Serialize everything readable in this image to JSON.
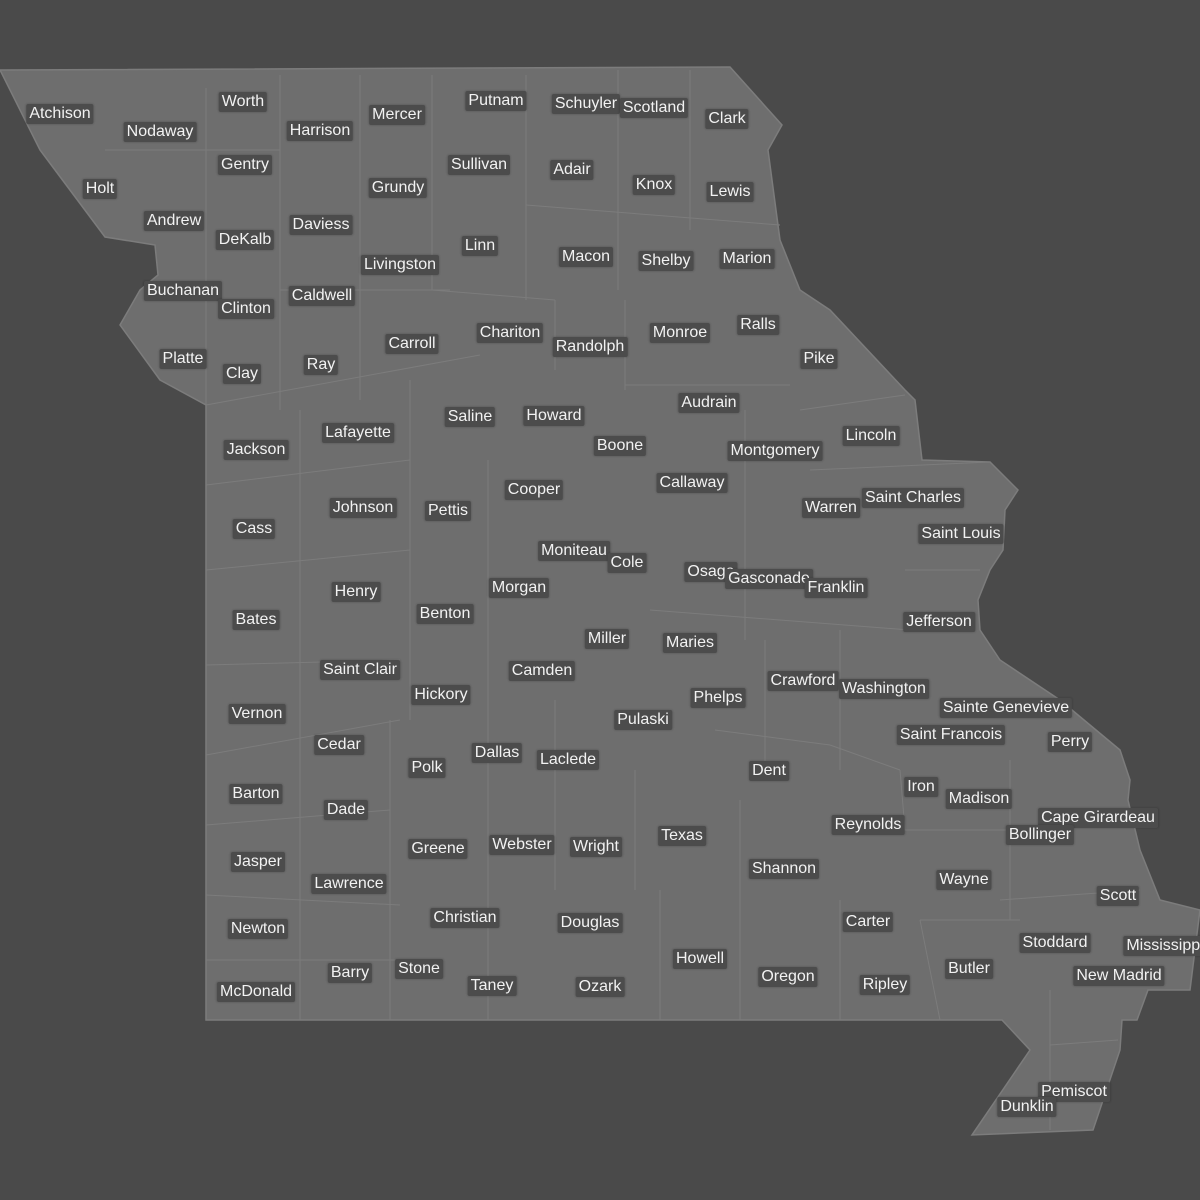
{
  "map": {
    "colors": {
      "background": "#4a4a4a",
      "land": "#6e6e6e",
      "border": "#7c7c7c",
      "label_bg": "#4c4c4c",
      "label_text": "#f2f2f2"
    },
    "counties": [
      "Atchison",
      "Nodaway",
      "Worth",
      "Harrison",
      "Mercer",
      "Putnam",
      "Schuyler",
      "Scotland",
      "Clark",
      "Holt",
      "Gentry",
      "Grundy",
      "Sullivan",
      "Adair",
      "Knox",
      "Lewis",
      "Andrew",
      "DeKalb",
      "Daviess",
      "Livingston",
      "Linn",
      "Macon",
      "Shelby",
      "Marion",
      "Buchanan",
      "Clinton",
      "Caldwell",
      "Carroll",
      "Chariton",
      "Randolph",
      "Monroe",
      "Ralls",
      "Pike",
      "Platte",
      "Clay",
      "Ray",
      "Saline",
      "Howard",
      "Audrain",
      "Lincoln",
      "Jackson",
      "Lafayette",
      "Boone",
      "Montgomery",
      "Callaway",
      "Cooper",
      "Johnson",
      "Pettis",
      "Warren",
      "Saint Charles",
      "Saint Louis",
      "Cass",
      "Moniteau",
      "Cole",
      "Osage",
      "Gasconade",
      "Franklin",
      "Henry",
      "Morgan",
      "Bates",
      "Benton",
      "Miller",
      "Maries",
      "Jefferson",
      "Saint Clair",
      "Camden",
      "Crawford",
      "Washington",
      "Vernon",
      "Hickory",
      "Phelps",
      "Pulaski",
      "Sainte Genevieve",
      "Saint Francois",
      "Perry",
      "Cedar",
      "Dallas",
      "Laclede",
      "Polk",
      "Dent",
      "Iron",
      "Madison",
      "Barton",
      "Dade",
      "Reynolds",
      "Cape Girardeau",
      "Bollinger",
      "Texas",
      "Webster",
      "Wright",
      "Greene",
      "Jasper",
      "Shannon",
      "Wayne",
      "Lawrence",
      "Scott",
      "Christian",
      "Douglas",
      "Carter",
      "Newton",
      "Stoddard",
      "Mississippi",
      "Howell",
      "Stone",
      "Barry",
      "Butler",
      "New Madrid",
      "Oregon",
      "Ripley",
      "Taney",
      "Ozark",
      "McDonald",
      "Pemiscot",
      "Dunklin"
    ]
  }
}
